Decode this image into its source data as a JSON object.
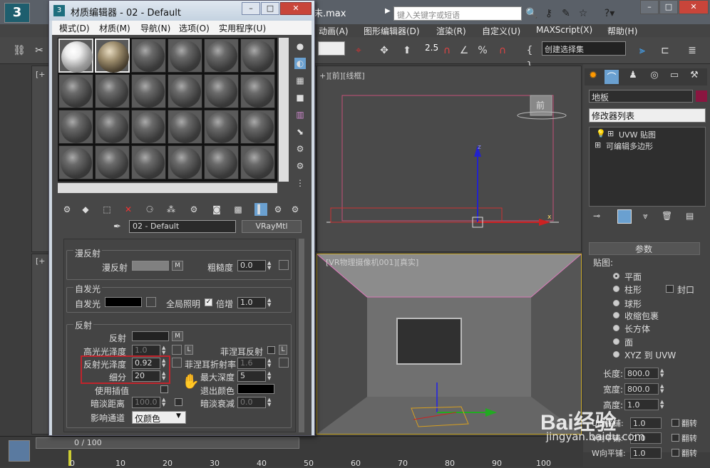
{
  "bg_app": {
    "file_title": "未.max",
    "search_placeholder": "键入关键字或短语",
    "menu": [
      "动画(A)",
      "图形编辑器(D)",
      "渲染(R)",
      "自定义(U)",
      "MAXScript(X)",
      "帮助(H)"
    ],
    "toolbar": {
      "snap_value": "2.5",
      "selection_set": "创建选择集"
    },
    "viewports": {
      "top_right_label": "+][前][线框]",
      "top_left_label": "[+",
      "bottom_left_label": "[+",
      "bottom_right_label": "[VR物理摄像机001][真实] ",
      "viewcube_label": "前",
      "axis_x": "x",
      "axis_y": "y",
      "axis_z": "z"
    },
    "command_panel": {
      "object_name": "地板",
      "modifier_list": "修改器列表",
      "stack": [
        "UVW 贴图",
        "可编辑多边形"
      ],
      "rollout_title": "参数",
      "mapping_group": "贴图:",
      "mapping_options": [
        "平面",
        "柱形",
        "球形",
        "收缩包裹",
        "长方体",
        "面",
        "XYZ 到 UVW"
      ],
      "cap_label": "封口",
      "length_label": "长度:",
      "length_value": "800.0",
      "width_label": "宽度:",
      "width_value": "800.0",
      "height_label": "高度:",
      "height_value": "1.0",
      "u_tile_label": "U向平铺:",
      "u_tile_value": "1.0",
      "v_tile_label": "V向平铺:",
      "v_tile_value": "1.0",
      "w_tile_label": "W向平铺:",
      "w_tile_value": "1.0",
      "flip_label": "翻转"
    },
    "timeline": {
      "frame_counter": "0 / 100",
      "ticks": [
        "0",
        "10",
        "20",
        "30",
        "40",
        "50",
        "60",
        "70",
        "80",
        "90",
        "100"
      ]
    },
    "watermark": "Bai经验",
    "watermark_url": "jingyan.baidu.com"
  },
  "material_editor": {
    "title": "材质编辑器 - 02 - Default",
    "menu": [
      "模式(D)",
      "材质(M)",
      "导航(N)",
      "选项(O)",
      "实用程序(U)"
    ],
    "material_name": "02 - Default",
    "material_type": "VRayMtl",
    "diffuse": {
      "group_title": "漫反射",
      "diffuse_label": "漫反射",
      "map_btn": "M",
      "roughness_label": "粗糙度",
      "roughness_value": "0.0"
    },
    "self_illum": {
      "group_title": "自发光",
      "label": "自发光",
      "gi_label": "全局照明",
      "mult_label": "倍增",
      "mult_value": "1.0"
    },
    "reflection": {
      "group_title": "反射",
      "reflect_label": "反射",
      "map_btn": "M",
      "hilight_gloss_label": "高光光泽度",
      "hilight_gloss_value": "1.0",
      "l_btn": "L",
      "fresnel_label": "菲涅耳反射",
      "fresnel_ior_label": "菲涅耳折射率",
      "fresnel_ior_value": "1.6",
      "refl_gloss_label": "反射光泽度",
      "refl_gloss_value": "0.92",
      "subdivs_label": "细分",
      "subdivs_value": "20",
      "max_depth_label": "最大深度",
      "max_depth_value": "5",
      "use_interp_label": "使用插值",
      "exit_color_label": "退出颜色",
      "dim_dist_label": "暗淡距离",
      "dim_dist_value": "100.0",
      "dim_falloff_label": "暗淡衰减",
      "dim_falloff_value": "0.0",
      "affect_channels_label": "影响通道",
      "affect_channels_value": "仅颜色"
    }
  }
}
